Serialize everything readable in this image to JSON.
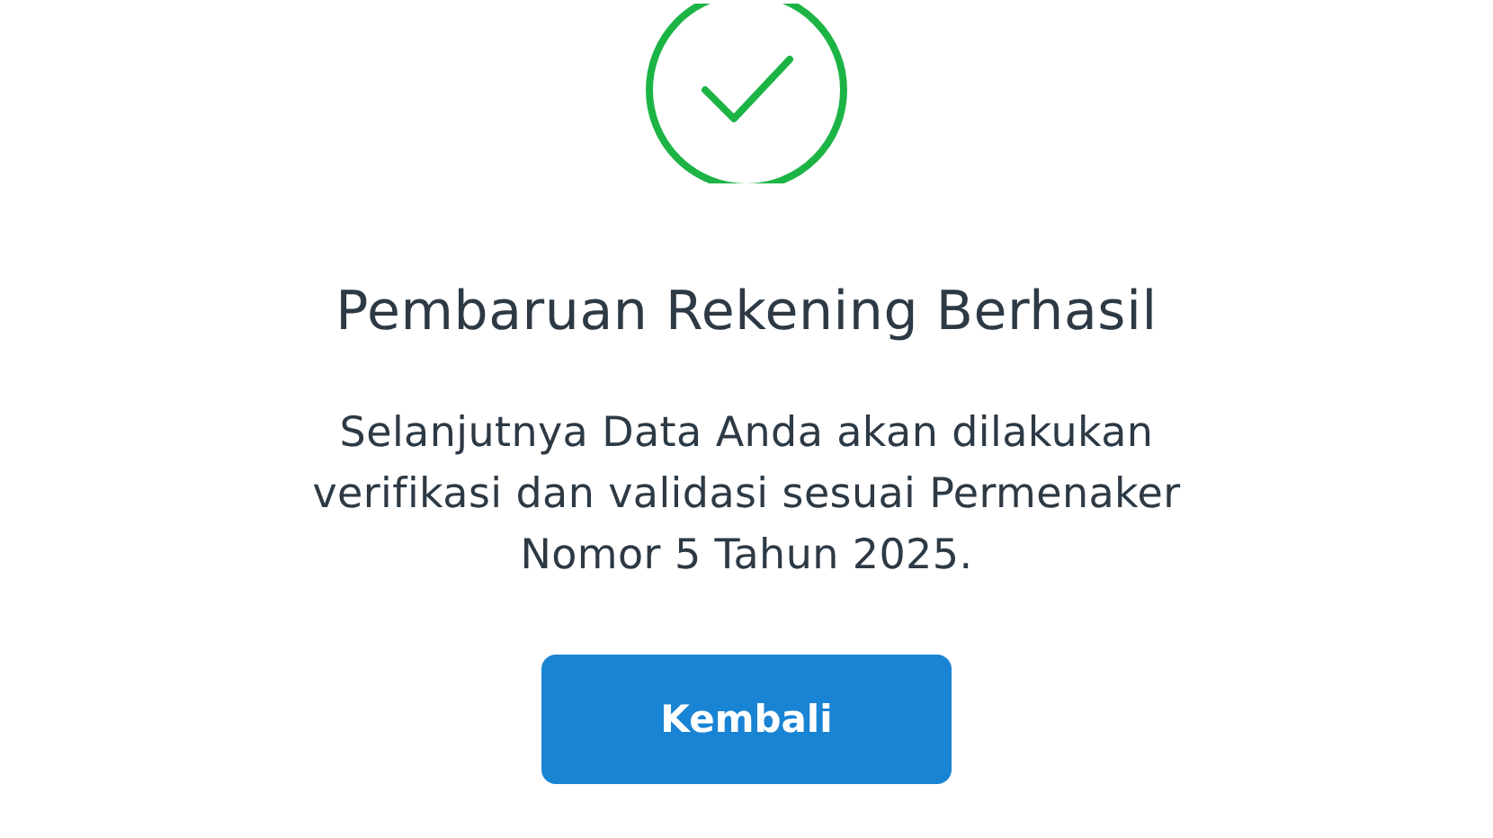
{
  "status": {
    "kind": "success"
  },
  "title": "Pembaruan Rekening Berhasil",
  "message": [
    "Selanjutnya Data Anda akan dilakukan",
    "verifikasi dan validasi sesuai Permenaker",
    "Nomor 5 Tahun 2025."
  ],
  "button": {
    "label": "Kembali"
  }
}
